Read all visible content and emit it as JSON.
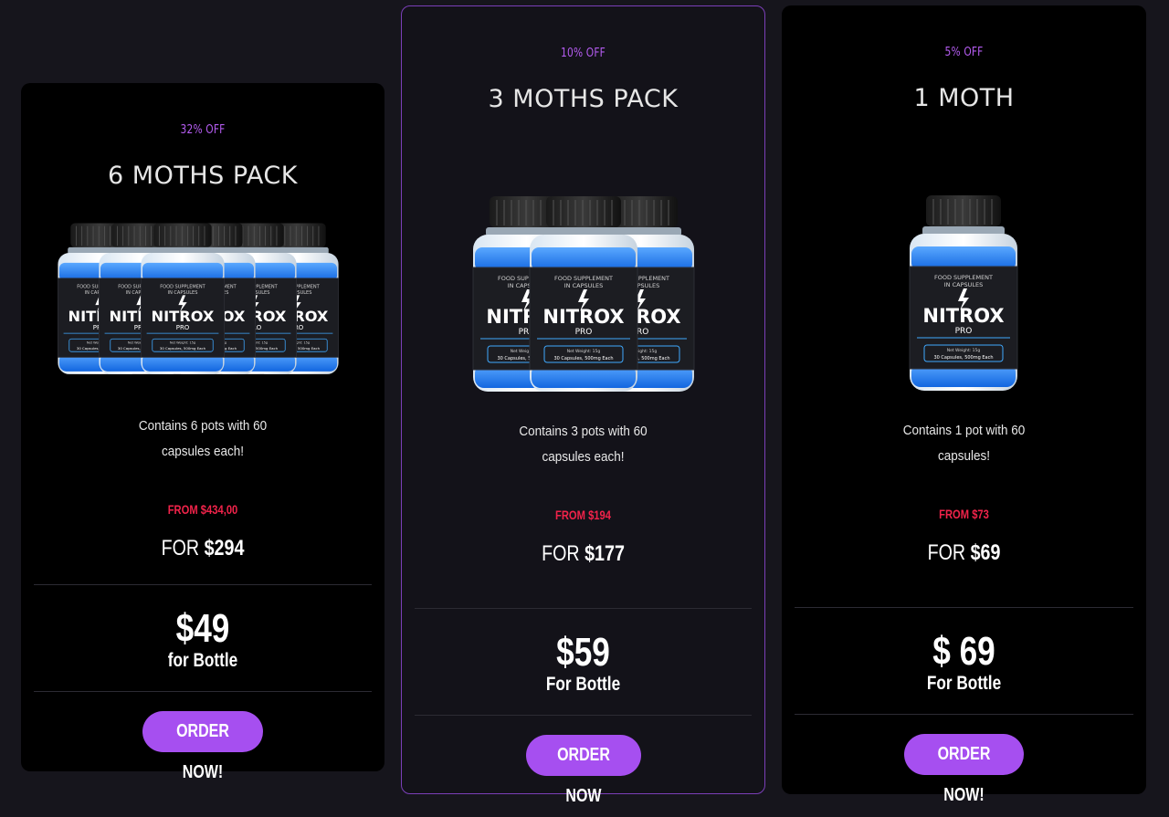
{
  "colors": {
    "page_background": "#16151c",
    "card_background": "#000000",
    "featured_card_background": "#131219",
    "featured_border": "#7b3fb8",
    "accent_purple": "#a64ff0",
    "discount_text": "#b45cf0",
    "old_price_red": "#f0234a"
  },
  "bottle": {
    "line1": "FOOD SUPPLEMENT",
    "line2": "IN CAPSULES",
    "brand": "NITROX",
    "sub": "PRO",
    "weight": "Net Weight: 15g",
    "capsules": "30 Capsules, 500mg Each",
    "icon": "lightning-bolt-icon"
  },
  "plans": [
    {
      "discount": "32% OFF",
      "title": "6 MOTHS PACK",
      "bottle_count": 6,
      "description_line1": "Contains 6 pots with 60",
      "description_line2": "capsules each!",
      "old_price": "FROM $434,00",
      "new_price_prefix": "FOR",
      "new_price": "$294",
      "unit_price": "$49",
      "unit_label": "for Bottle",
      "button_label": "ORDER NOW!"
    },
    {
      "discount": "10% OFF",
      "title": "3 MOTHS PACK",
      "bottle_count": 3,
      "description_line1": "Contains 3 pots with 60",
      "description_line2": "capsules each!",
      "old_price": "FROM $194",
      "new_price_prefix": "FOR",
      "new_price": "$177",
      "unit_price": "$59",
      "unit_label": "For Bottle",
      "button_label": "ORDER NOW"
    },
    {
      "discount": "5% OFF",
      "title": "1 MOTH",
      "bottle_count": 1,
      "description_line1": "Contains 1 pot with 60",
      "description_line2": "capsules!",
      "old_price": "FROM $73",
      "new_price_prefix": "FOR",
      "new_price": "$69",
      "unit_price": "$ 69",
      "unit_label": "For Bottle",
      "button_label": "ORDER NOW!"
    }
  ]
}
